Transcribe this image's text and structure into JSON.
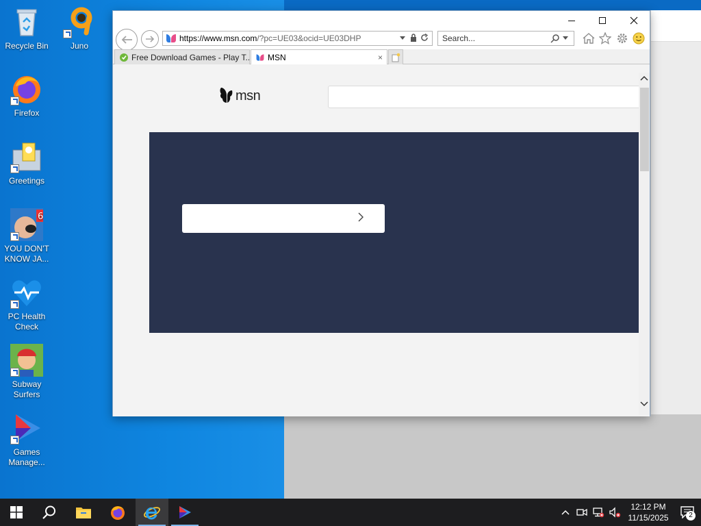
{
  "desktop": {
    "icons": [
      {
        "label": "Recycle Bin",
        "icon": "recycle-bin-icon"
      },
      {
        "label": "Juno",
        "icon": "juno-icon"
      },
      {
        "label": "Firefox",
        "icon": "firefox-icon"
      },
      {
        "label": "Greetings",
        "icon": "greetings-icon"
      },
      {
        "label": "YOU DON'T KNOW JA...",
        "icon": "you-dont-know-jack-icon"
      },
      {
        "label": "PC Health Check",
        "icon": "pc-health-check-icon"
      },
      {
        "label": "Subway Surfers",
        "icon": "subway-surfers-icon"
      },
      {
        "label": "Games Manage...",
        "icon": "games-manager-icon"
      }
    ]
  },
  "browser": {
    "url_host": "https://www.msn.com",
    "url_rest": "/?pc=UE03&ocid=UE03DHP",
    "search_placeholder": "Search...",
    "tabs": [
      {
        "label": "Free Download Games - Play T...",
        "active": false
      },
      {
        "label": "MSN",
        "active": true
      }
    ],
    "close_glyph": "×"
  },
  "page": {
    "logo_text": "msn",
    "accent_color": "#29334e"
  },
  "taskbar": {
    "time": "12:12 PM",
    "date": "11/15/2025",
    "notification_count": "2"
  }
}
